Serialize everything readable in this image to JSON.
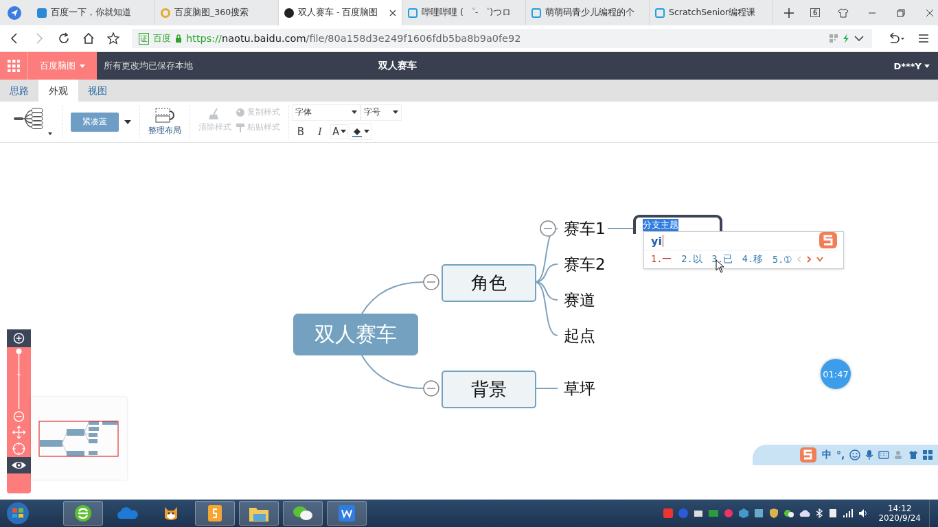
{
  "browser_tabs": [
    {
      "title": "百度一下，你就知道",
      "selected": false
    },
    {
      "title": "百度脑图_360搜索",
      "selected": false
    },
    {
      "title": "双人赛车 - 百度脑图",
      "selected": true
    },
    {
      "title": "哔哩哔哩 ( ゜- ゜)つロ",
      "selected": false
    },
    {
      "title": "萌萌码青少儿编程的个",
      "selected": false
    },
    {
      "title": "ScratchSenior编程课",
      "selected": false
    }
  ],
  "tab_count": "6",
  "address": {
    "badge": "证",
    "site": "百度",
    "scheme": "https://",
    "host": "naotu.baidu.com",
    "path": "/file/80a158d3e249f1606fdb5ba8b9a0fe92"
  },
  "app_header": {
    "brand": "百度脑图",
    "status": "所有更改均已保存本地",
    "title": "双人赛车",
    "user": "D***Y"
  },
  "menu_tabs": [
    {
      "label": "思路",
      "selected": false
    },
    {
      "label": "外观",
      "selected": true
    },
    {
      "label": "视图",
      "selected": false
    }
  ],
  "toolbar": {
    "theme": "紧凑蓝",
    "layout": "整理布局",
    "style_tools": [
      {
        "label": "清除样式",
        "disabled": true
      },
      {
        "label": "复制样式",
        "disabled": true
      },
      {
        "label": "粘贴样式",
        "disabled": true
      }
    ],
    "font": "字体",
    "size": "字号",
    "bold": "B",
    "italic": "I",
    "font_color": "A"
  },
  "mindmap": {
    "root": "双人赛车",
    "branches": [
      {
        "label": "角色",
        "expanded": true,
        "children": [
          {
            "label": "赛车1",
            "children": [
              {
                "kind": "editing",
                "selected_text": "分支主题"
              }
            ]
          },
          {
            "label": "赛车2"
          },
          {
            "label": "赛道"
          },
          {
            "label": "起点"
          }
        ]
      },
      {
        "label": "背景",
        "expanded": true,
        "children": [
          {
            "label": "草坪"
          }
        ]
      }
    ]
  },
  "ime_popup": {
    "input": "yi",
    "candidates": [
      "1.一",
      "2.以",
      "3.已",
      "4.移",
      "5.①"
    ]
  },
  "timer": "01:47",
  "zoom_slider": {
    "level": 1
  },
  "ime_status": [
    "中",
    "°,"
  ],
  "clock": {
    "time": "14:12",
    "date": "2020/9/24"
  }
}
